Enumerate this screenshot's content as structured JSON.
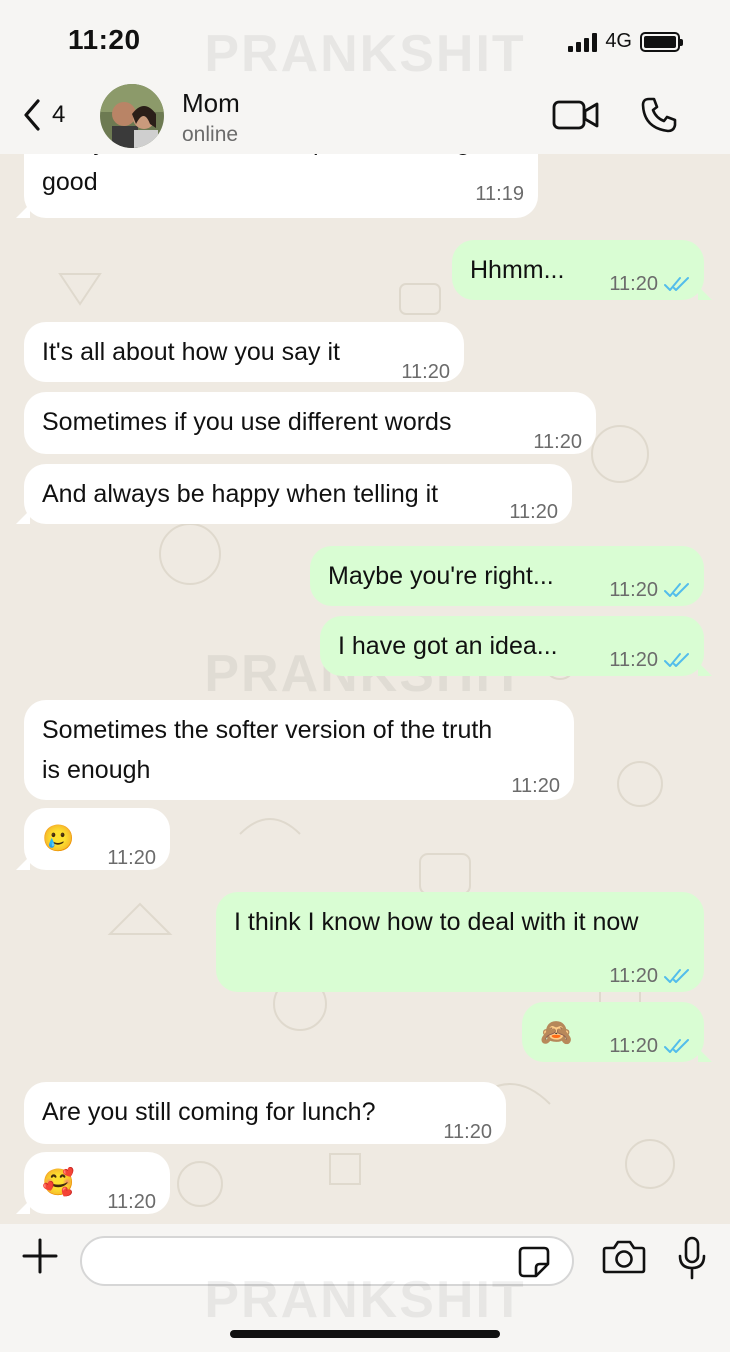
{
  "status_bar": {
    "time": "11:20",
    "network": "4G"
  },
  "header": {
    "back_count": "4",
    "contact_name": "Mom",
    "contact_status": "online"
  },
  "watermark": "PRANKSHIT",
  "messages": [
    {
      "dir": "in",
      "text": "And you leave the other person feeling",
      "text2": "good",
      "time": "11:19"
    },
    {
      "dir": "out",
      "text": "Hhmm...",
      "time": "11:20",
      "read": true
    },
    {
      "dir": "in",
      "text": "It's all about how you say it",
      "time": "11:20"
    },
    {
      "dir": "in",
      "text": "Sometimes if you use different words",
      "time": "11:20"
    },
    {
      "dir": "in",
      "text": "And always be happy when telling it",
      "time": "11:20"
    },
    {
      "dir": "out",
      "text": "Maybe you're right...",
      "time": "11:20",
      "read": true
    },
    {
      "dir": "out",
      "text": "I have got an idea...",
      "time": "11:20",
      "read": true
    },
    {
      "dir": "in",
      "text": "Sometimes the softer version of the truth",
      "text2": "is enough",
      "time": "11:20"
    },
    {
      "dir": "in",
      "text": "🥲",
      "time": "11:20"
    },
    {
      "dir": "out",
      "text": "I think I know how to deal with it now",
      "time": "11:20",
      "read": true
    },
    {
      "dir": "out",
      "text": "🙈",
      "time": "11:20",
      "read": true
    },
    {
      "dir": "in",
      "text": "Are you still coming for lunch?",
      "time": "11:20"
    },
    {
      "dir": "in",
      "text": "🥰",
      "time": "11:20"
    }
  ],
  "composer": {
    "placeholder": ""
  },
  "colors": {
    "incoming": "#ffffff",
    "outgoing": "#d9fdd3",
    "tick_blue": "#53bdeb"
  },
  "icons": [
    "back-chevron-icon",
    "video-call-icon",
    "phone-icon",
    "plus-icon",
    "sticker-icon",
    "camera-icon",
    "microphone-icon",
    "double-check-icon"
  ]
}
